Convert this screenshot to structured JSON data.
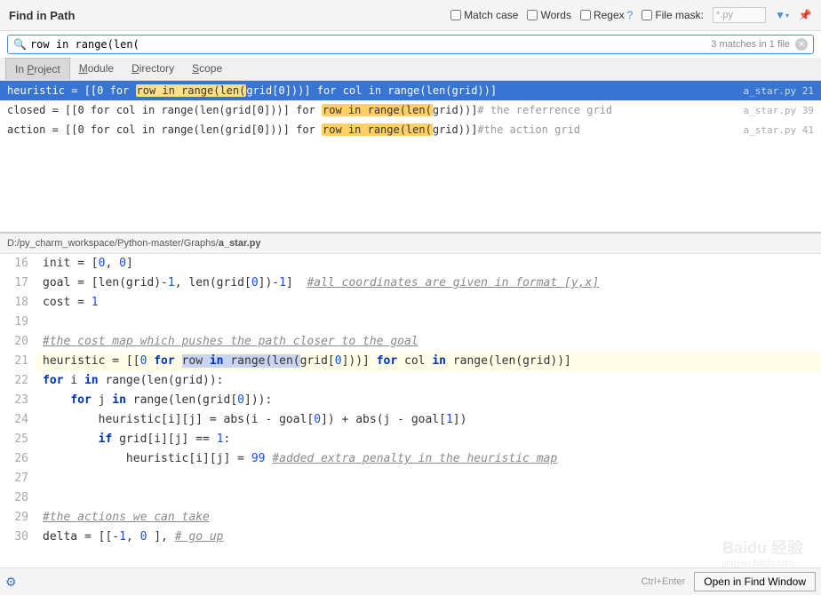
{
  "header": {
    "title": "Find in Path",
    "match_case": "Match case",
    "words": "Words",
    "regex": "Regex",
    "regex_help": "?",
    "file_mask": "File mask:",
    "mask_value": "*.py"
  },
  "search": {
    "query": "row in range(len(",
    "matches": "3 matches in 1 file"
  },
  "tabs": {
    "project": "In Project",
    "module": "Module",
    "directory": "Directory",
    "scope": "Scope"
  },
  "results": [
    {
      "pre": "heuristic = [[0 for ",
      "hl": "row in range(len(",
      "post1": "grid[0]))] for col in range(len(grid))]",
      "comment": "",
      "file": "a_star.py",
      "line": "21",
      "sel": true
    },
    {
      "pre": "closed = [[0 for col in range(len(grid[0]))] for ",
      "hl": "row in range(len(",
      "post1": "grid))]",
      "comment": "# the referrence grid",
      "file": "a_star.py",
      "line": "39",
      "sel": false
    },
    {
      "pre": "action = [[0 for col in range(len(grid[0]))] for ",
      "hl": "row in range(len(",
      "post1": "grid))]",
      "comment": "#the action grid",
      "file": "a_star.py",
      "line": "41",
      "sel": false
    }
  ],
  "path": {
    "dir": "D:/py_charm_workspace/Python-master/Graphs/",
    "file": "a_star.py"
  },
  "code": {
    "start": 16,
    "lines": [
      {
        "n": 16,
        "html": "init = [<span class='num'>0</span>, <span class='num'>0</span>]"
      },
      {
        "n": 17,
        "html": "goal = [len(grid)-<span class='num'>1</span>, len(grid[<span class='num'>0</span>])-<span class='num'>1</span>]  <span class='com'>#all coordinates are given in format [y,x]</span>"
      },
      {
        "n": 18,
        "html": "cost = <span class='num'>1</span>"
      },
      {
        "n": 19,
        "html": ""
      },
      {
        "n": 20,
        "html": "<span class='com'>#the cost map which pushes the path closer to the goal</span>"
      },
      {
        "n": 21,
        "hl": true,
        "html": "heuristic = [[<span class='num'>0</span> <span class='kw'>for</span> <span class='sel-bg'>row <span class='kw'>in</span> range(len(</span>grid[<span class='num'>0</span>]))] <span class='kw'>for</span> col <span class='kw'>in</span> range(len(grid))]"
      },
      {
        "n": 22,
        "html": "<span class='kw'>for</span> i <span class='kw'>in</span> range(len(grid)):"
      },
      {
        "n": 23,
        "html": "    <span class='kw'>for</span> j <span class='kw'>in</span> range(len(grid[<span class='num'>0</span>])):"
      },
      {
        "n": 24,
        "html": "        heuristic[i][j] = abs(i - goal[<span class='num'>0</span>]) + abs(j - goal[<span class='num'>1</span>])"
      },
      {
        "n": 25,
        "html": "        <span class='kw'>if</span> grid[i][j] == <span class='num'>1</span>:"
      },
      {
        "n": 26,
        "html": "            heuristic[i][j] = <span class='num'>99</span> <span class='com'>#added extra penalty in the heuristic map</span>"
      },
      {
        "n": 27,
        "html": ""
      },
      {
        "n": 28,
        "html": ""
      },
      {
        "n": 29,
        "html": "<span class='com'>#the actions we can take</span>"
      },
      {
        "n": 30,
        "html": "delta = [[-<span class='num'>1</span>, <span class='num'>0</span> ], <span class='com'># go up</span>"
      }
    ]
  },
  "footer": {
    "hint": "Ctrl+Enter",
    "open": "Open in Find Window"
  },
  "watermark": {
    "brand": "Baidu 经验",
    "url": "jingyan.baidu.com"
  }
}
